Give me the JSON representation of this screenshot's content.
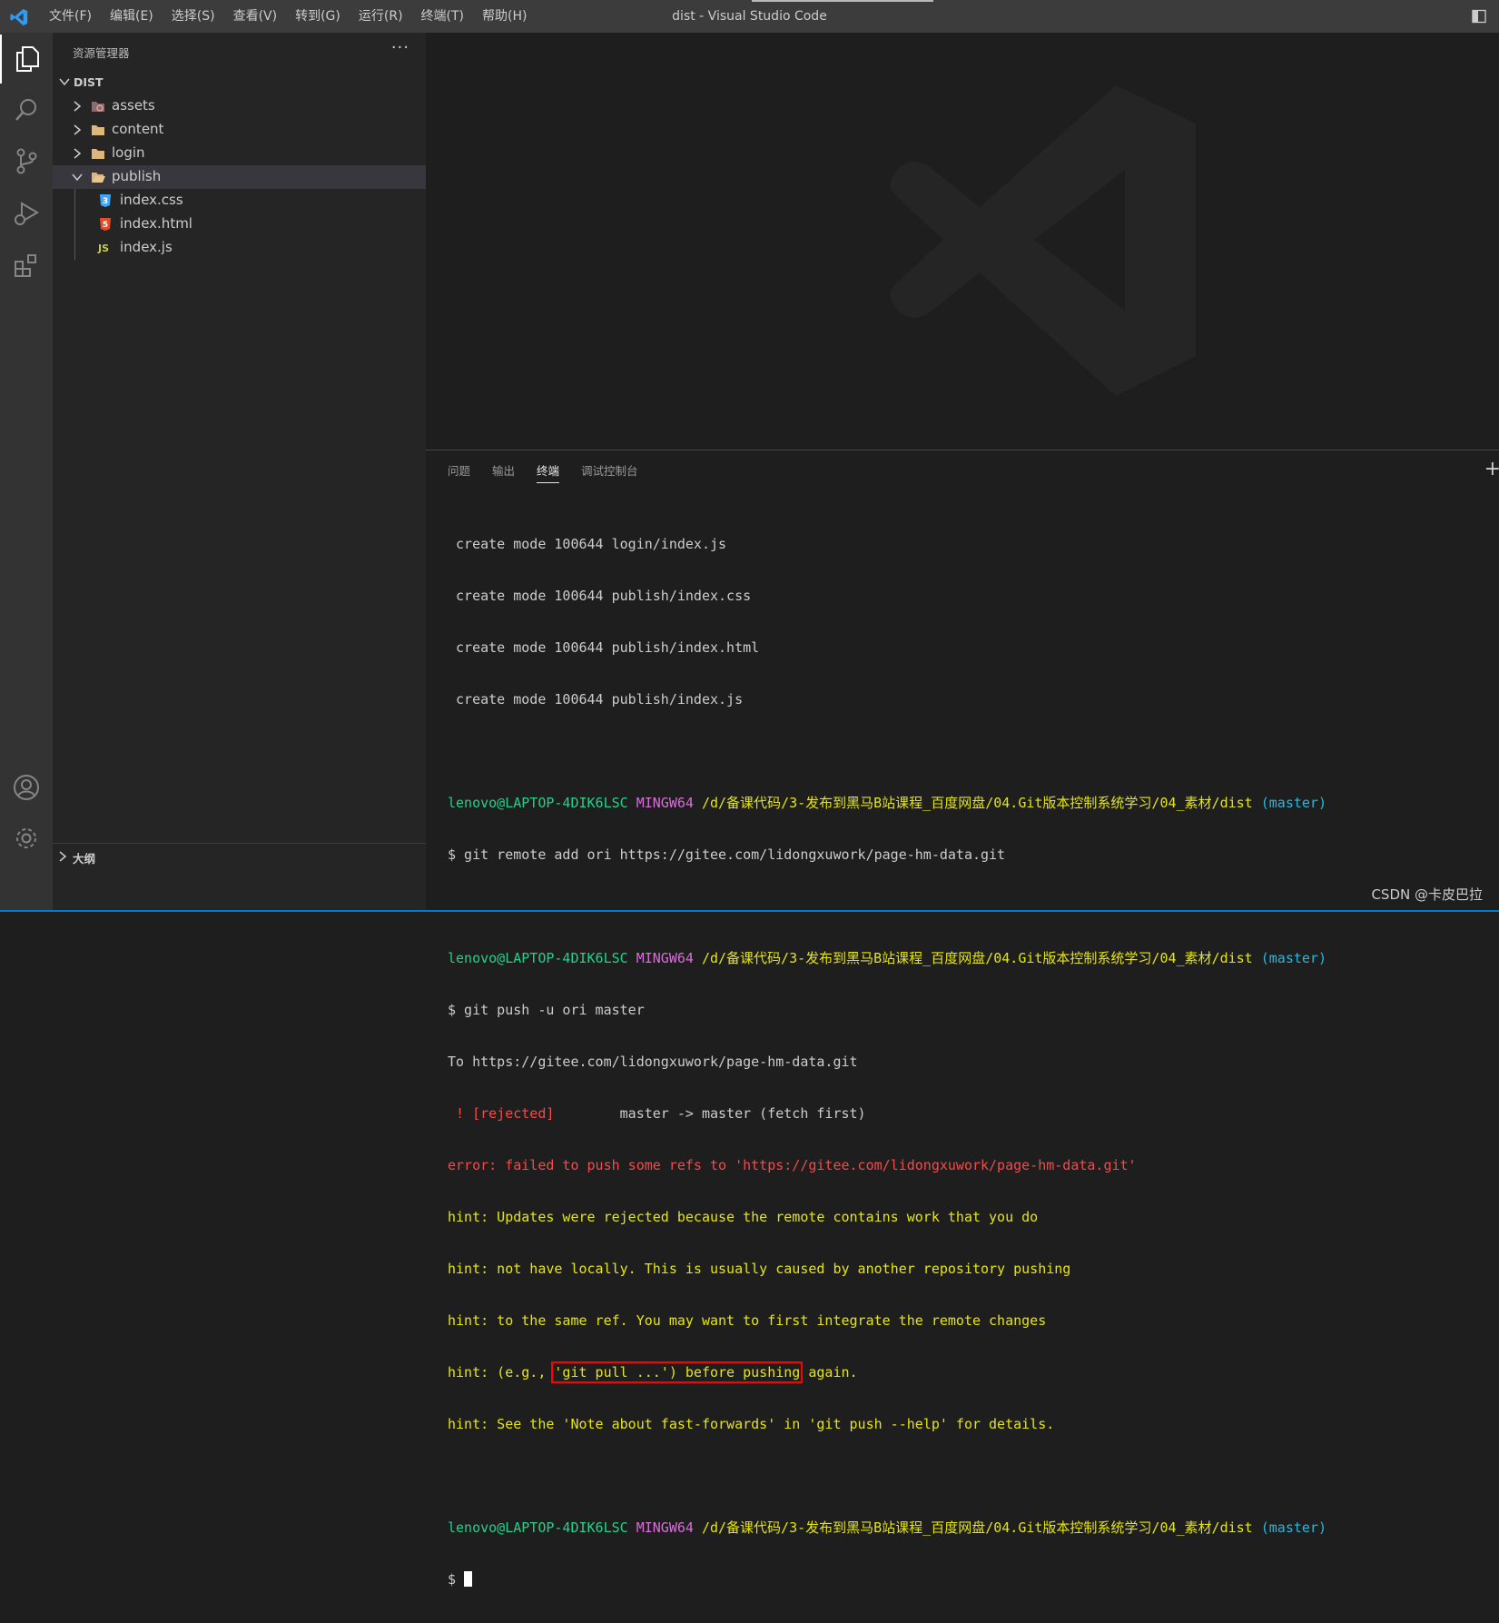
{
  "window": {
    "title": "dist - Visual Studio Code"
  },
  "menu": [
    "文件(F)",
    "编辑(E)",
    "选择(S)",
    "查看(V)",
    "转到(G)",
    "运行(R)",
    "终端(T)",
    "帮助(H)"
  ],
  "activity_bar": {
    "items": [
      "explorer-icon",
      "search-icon",
      "source-control-icon",
      "run-debug-icon",
      "extensions-icon"
    ],
    "bottom": [
      "account-icon",
      "gear-icon"
    ]
  },
  "explorer": {
    "heading": "资源管理器",
    "more": "···",
    "root": "DIST",
    "folders": [
      {
        "name": "assets",
        "expanded": false
      },
      {
        "name": "content",
        "expanded": false
      },
      {
        "name": "login",
        "expanded": false
      },
      {
        "name": "publish",
        "expanded": true,
        "selected": true
      }
    ],
    "files": [
      {
        "name": "index.css",
        "icon": "css-file-icon",
        "badge": "3",
        "color": "#42a5f5"
      },
      {
        "name": "index.html",
        "icon": "html-file-icon",
        "badge": "5",
        "color": "#e44d26"
      },
      {
        "name": "index.js",
        "icon": "js-file-icon",
        "badge": "JS",
        "color": "#cbcb41"
      }
    ],
    "outline": "大纲"
  },
  "panel": {
    "tabs": [
      "问题",
      "输出",
      "终端",
      "调试控制台"
    ],
    "active_tab": "终端",
    "plus": "+"
  },
  "terminal": {
    "prompt": {
      "user": "lenovo@LAPTOP-4DIK6LSC",
      "env": "MINGW64",
      "path": "/d/备课代码/3-发布到黑马B站课程_百度网盘/04.Git版本控制系统学习/04_素材/dist",
      "branch": "(master)"
    },
    "create_lines": [
      " create mode 100644 login/index.js",
      " create mode 100644 publish/index.css",
      " create mode 100644 publish/index.html",
      " create mode 100644 publish/index.js"
    ],
    "cmd1": "$ git remote add ori https://gitee.com/lidongxuwork/page-hm-data.git",
    "cmd2": "$ git push -u ori master",
    "to_line": "To https://gitee.com/lidongxuwork/page-hm-data.git",
    "rejected_tag": " ! [rejected]",
    "rejected_rest": "        master -> master (fetch first)",
    "error_line": "error: failed to push some refs to 'https://gitee.com/lidongxuwork/page-hm-data.git'",
    "hint1": "hint: Updates were rejected because the remote contains work that you do",
    "hint2": "hint: not have locally. This is usually caused by another repository pushing",
    "hint3": "hint: to the same ref. You may want to first integrate the remote changes",
    "hint4_pre": "hint: (e.g., ",
    "hint4_boxed": "'git pull ...') before pushing",
    "hint4_post": " again.",
    "hint5": "hint: See the 'Note about fast-forwards' in 'git push --help' for details.",
    "final_prompt": "$ "
  },
  "watermark_text": "CSDN @卡皮巴拉",
  "colors": {
    "accent": "#007acc",
    "selection": "#37373d",
    "error_box": "#ff0000"
  }
}
